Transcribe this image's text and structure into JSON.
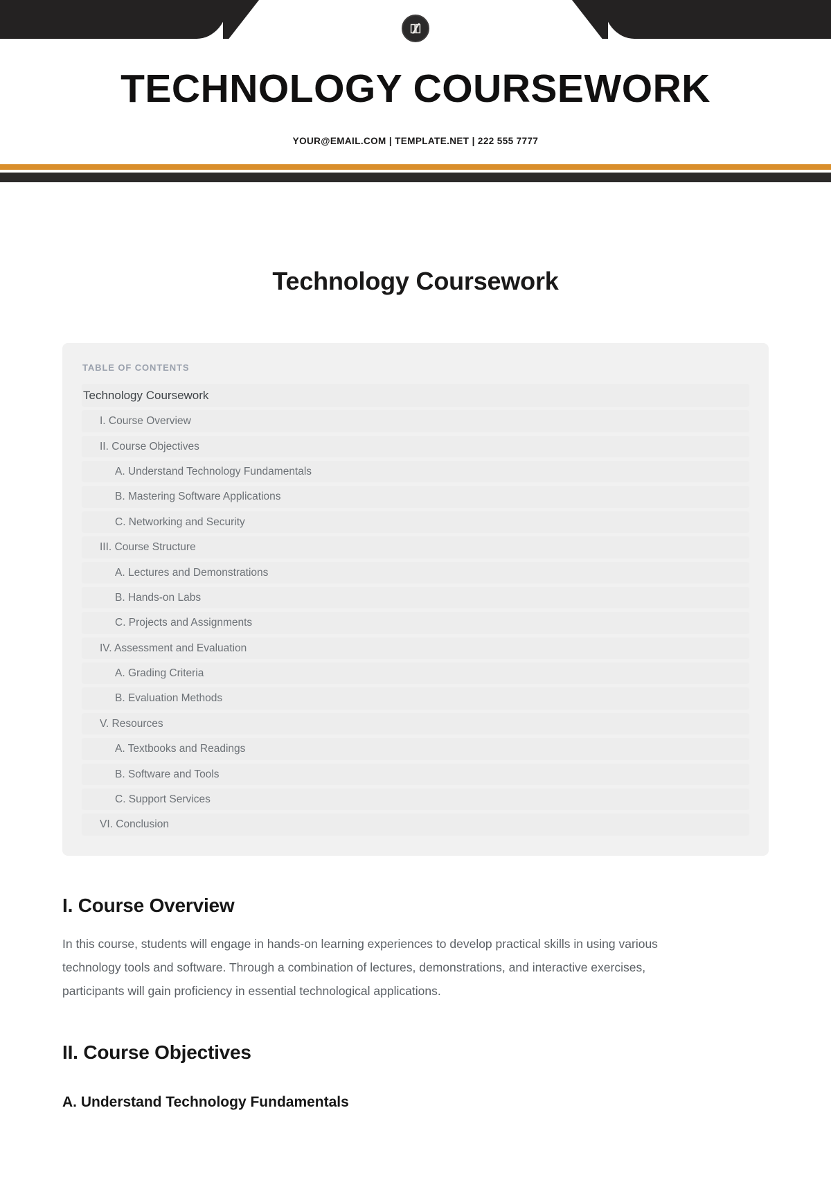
{
  "letterhead": {
    "logo_icon": "book-quill-logo-icon",
    "title": "TECHNOLOGY COURSEWORK",
    "contact": "YOUR@EMAIL.COM | TEMPLATE.NET | 222 555 7777",
    "accent_color": "#d98e2b",
    "dark_color": "#2c2a29"
  },
  "document": {
    "heading": "Technology Coursework"
  },
  "toc": {
    "label": "TABLE OF CONTENTS",
    "items": [
      {
        "text": "Technology Coursework",
        "level": 0
      },
      {
        "text": "I. Course Overview",
        "level": 1
      },
      {
        "text": "II. Course Objectives",
        "level": 1
      },
      {
        "text": "A. Understand Technology Fundamentals",
        "level": 2
      },
      {
        "text": "B. Mastering Software Applications",
        "level": 2
      },
      {
        "text": "C. Networking and Security",
        "level": 2
      },
      {
        "text": "III. Course Structure",
        "level": 1
      },
      {
        "text": "A. Lectures and Demonstrations",
        "level": 2
      },
      {
        "text": "B. Hands-on Labs",
        "level": 2
      },
      {
        "text": "C. Projects and Assignments",
        "level": 2
      },
      {
        "text": "IV. Assessment and Evaluation",
        "level": 1
      },
      {
        "text": "A. Grading Criteria",
        "level": 2
      },
      {
        "text": "B. Evaluation Methods",
        "level": 2
      },
      {
        "text": "V. Resources",
        "level": 1
      },
      {
        "text": "A. Textbooks and Readings",
        "level": 2
      },
      {
        "text": "B. Software and Tools",
        "level": 2
      },
      {
        "text": "C. Support Services",
        "level": 2
      },
      {
        "text": "VI. Conclusion",
        "level": 1
      }
    ]
  },
  "sections": {
    "overview_heading": "I. Course Overview",
    "overview_body": "In this course, students will engage in hands-on learning experiences to develop practical skills in using various technology tools and software. Through a combination of lectures, demonstrations, and interactive exercises, participants will gain proficiency in essential technological applications.",
    "objectives_heading": "II. Course Objectives",
    "objectives_sub_a": "A. Understand Technology Fundamentals"
  }
}
